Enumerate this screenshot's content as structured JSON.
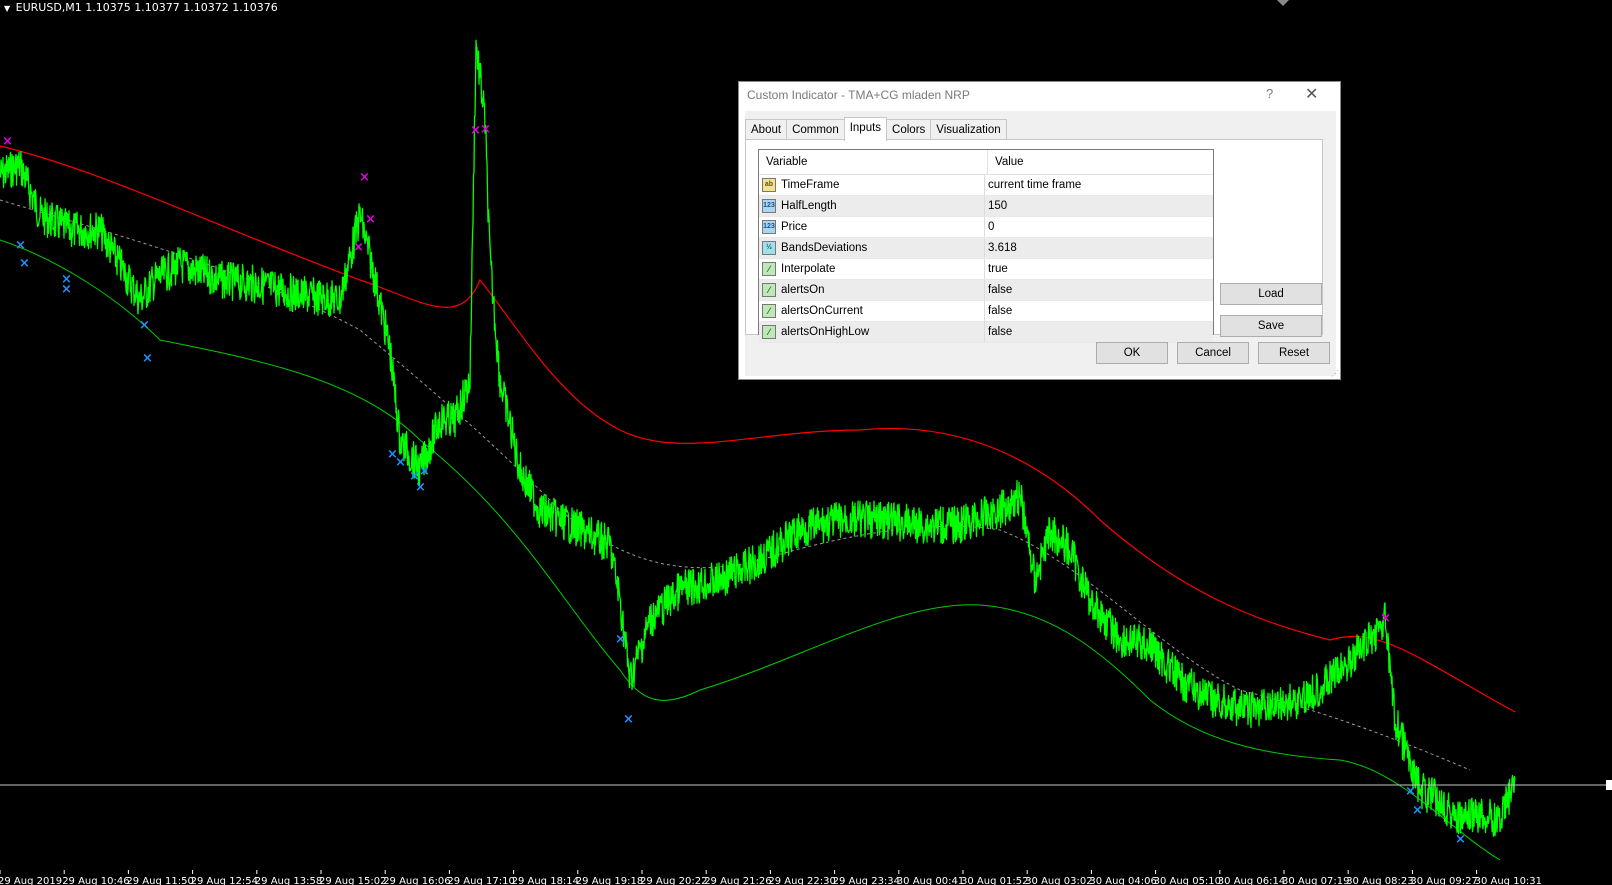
{
  "chart": {
    "symbol_label": "EURUSD,M1  1.10375 1.10377 1.10372 1.10376",
    "xaxis_labels": [
      "29 Aug 2019",
      "29 Aug 10:46",
      "29 Aug 11:50",
      "29 Aug 12:54",
      "29 Aug 13:58",
      "29 Aug 15:02",
      "29 Aug 16:06",
      "29 Aug 17:10",
      "29 Aug 18:14",
      "29 Aug 19:18",
      "29 Aug 20:22",
      "29 Aug 21:26",
      "29 Aug 22:30",
      "29 Aug 23:34",
      "30 Aug 00:41",
      "30 Aug 01:52",
      "30 Aug 03:02",
      "30 Aug 04:06",
      "30 Aug 05:10",
      "30 Aug 06:14",
      "30 Aug 07:19",
      "30 Aug 08:23",
      "30 Aug 09:27",
      "30 Aug 10:31"
    ],
    "colors": {
      "price": "#00ff00",
      "upper_band": "#ff0000",
      "lower_band": "#00cc00",
      "middle": "#aaaaaa",
      "sell_marker": "#e100e1",
      "buy_marker": "#1e90ff"
    }
  },
  "dialog": {
    "title": "Custom Indicator - TMA+CG mladen NRP",
    "help_label": "?",
    "close_label": "✕",
    "tabs": [
      {
        "label": "About",
        "active": false
      },
      {
        "label": "Common",
        "active": false
      },
      {
        "label": "Inputs",
        "active": true
      },
      {
        "label": "Colors",
        "active": false
      },
      {
        "label": "Visualization",
        "active": false
      }
    ],
    "headers": {
      "variable": "Variable",
      "value": "Value"
    },
    "rows": [
      {
        "icon_text": "ab",
        "type": "string",
        "variable": "TimeFrame",
        "value": "current time frame"
      },
      {
        "icon_text": "123",
        "type": "int",
        "variable": "HalfLength",
        "value": "150"
      },
      {
        "icon_text": "123",
        "type": "int",
        "variable": "Price",
        "value": "0"
      },
      {
        "icon_text": "½",
        "type": "double",
        "variable": "BandsDeviations",
        "value": "3.618"
      },
      {
        "icon_text": "⁄",
        "type": "bool",
        "variable": "Interpolate",
        "value": "true"
      },
      {
        "icon_text": "⁄",
        "type": "bool",
        "variable": "alertsOn",
        "value": "false"
      },
      {
        "icon_text": "⁄",
        "type": "bool",
        "variable": "alertsOnCurrent",
        "value": "false"
      },
      {
        "icon_text": "⁄",
        "type": "bool",
        "variable": "alertsOnHighLow",
        "value": "false"
      }
    ],
    "buttons": {
      "load": "Load",
      "save": "Save",
      "ok": "OK",
      "cancel": "Cancel",
      "reset": "Reset"
    }
  }
}
